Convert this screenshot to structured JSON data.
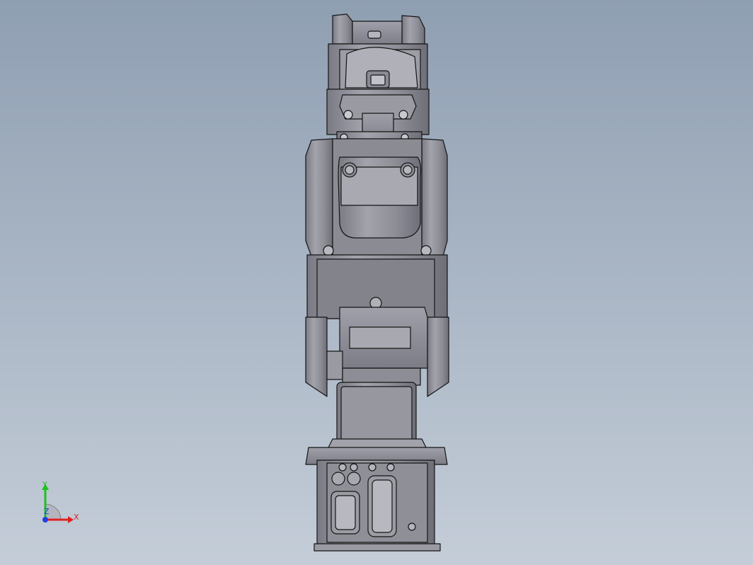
{
  "viewport": {
    "background_top": "#8f9fb2",
    "background_bottom": "#c4cdd8"
  },
  "model": {
    "fill": "#8e8e96",
    "fill_light": "#a9a9b2",
    "fill_dark": "#6f6f78",
    "edge": "#141414"
  },
  "triad": {
    "x_label": "X",
    "y_label": "Y",
    "z_label": "Z",
    "x_color": "#e02020",
    "y_color": "#20c020",
    "z_color": "#2040e0"
  }
}
